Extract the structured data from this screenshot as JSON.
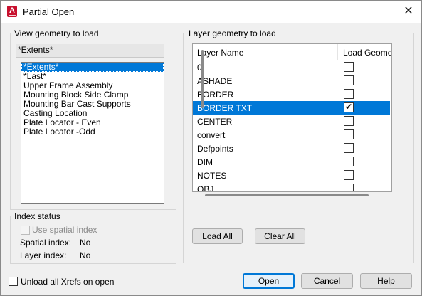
{
  "window": {
    "title": "Partial Open",
    "app_icon_letter": "A",
    "close_glyph": "✕"
  },
  "view_geometry": {
    "group_label": "View geometry to load",
    "current_value": "*Extents*",
    "items": [
      "*Extents*",
      "*Last*",
      "Upper Frame Assembly",
      "Mounting Block Side Clamp",
      "Mounting Bar Cast Supports",
      "Casting Location",
      "Plate Locator - Even",
      "Plate Locator -Odd"
    ],
    "selected_index": 0
  },
  "layer_geometry": {
    "group_label": "Layer geometry to load",
    "columns": [
      "Layer Name",
      "Load Geometry"
    ],
    "rows": [
      {
        "name": "0",
        "checked": false
      },
      {
        "name": "ASHADE",
        "checked": false
      },
      {
        "name": "BORDER",
        "checked": false
      },
      {
        "name": "BORDER TXT",
        "checked": true
      },
      {
        "name": "CENTER",
        "checked": false
      },
      {
        "name": "convert",
        "checked": false
      },
      {
        "name": "Defpoints",
        "checked": false
      },
      {
        "name": "DIM",
        "checked": false
      },
      {
        "name": "NOTES",
        "checked": false
      },
      {
        "name": "OBJ",
        "checked": false
      }
    ],
    "selected_index": 3,
    "load_all_label": "Load All",
    "clear_all_label": "Clear All"
  },
  "index_status": {
    "group_label": "Index status",
    "use_spatial_index_label": "Use spatial index",
    "spatial_index_label": "Spatial index:",
    "spatial_index_value": "No",
    "layer_index_label": "Layer index:",
    "layer_index_value": "No"
  },
  "footer": {
    "unload_xrefs_label": "Unload all Xrefs on open",
    "open_label": "Open",
    "cancel_label": "Cancel",
    "help_label": "Help"
  },
  "colors": {
    "selection": "#0078d7",
    "brand": "#c8102e"
  }
}
